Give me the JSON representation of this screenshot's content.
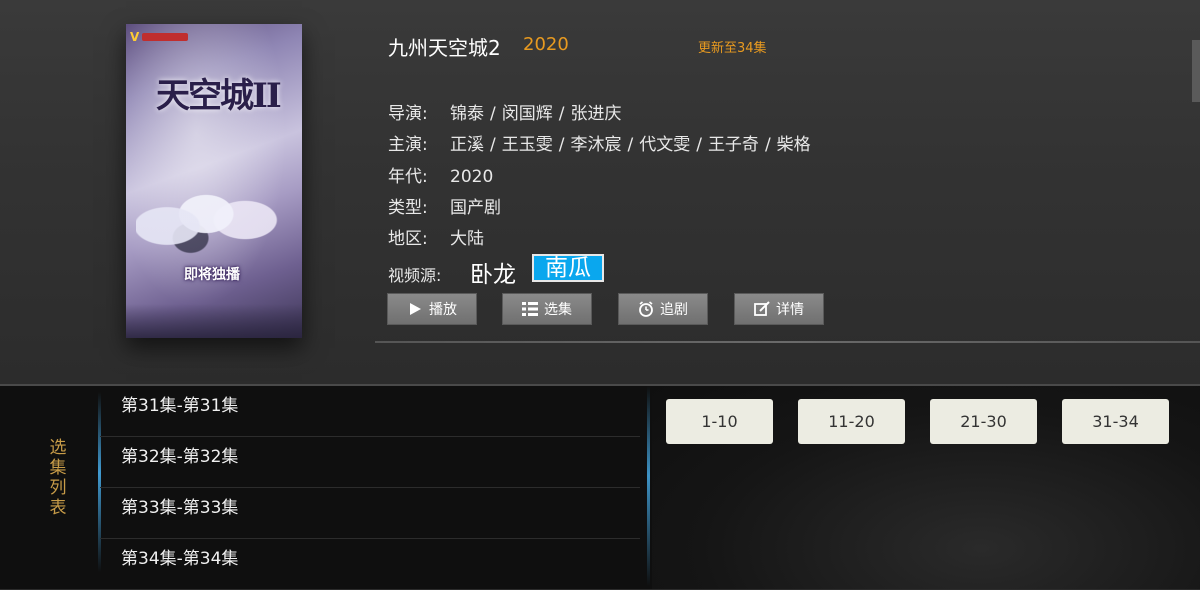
{
  "poster": {
    "brand": "V",
    "title_art": "天空城II",
    "banner": "即将独播"
  },
  "show": {
    "title": "九州天空城2",
    "year_tag": "2020",
    "update_status": "更新至34集"
  },
  "details": {
    "director_label": "导演:",
    "directors": [
      "锦泰",
      "闵国辉",
      "张进庆"
    ],
    "cast_label": "主演:",
    "cast": [
      "正溪",
      "王玉雯",
      "李沐宸",
      "代文雯",
      "王子奇",
      "柴格"
    ],
    "year_label": "年代:",
    "year": "2020",
    "genre_label": "类型:",
    "genre": "国产剧",
    "region_label": "地区:",
    "region": "大陆"
  },
  "sources": {
    "label": "视频源:",
    "items": [
      "卧龙",
      "南瓜"
    ],
    "selected": "南瓜"
  },
  "actions": {
    "play": "播放",
    "episodes": "选集",
    "follow": "追剧",
    "details": "详情"
  },
  "episode_panel": {
    "side_label": [
      "选",
      "集",
      "列",
      "表"
    ],
    "episodes": [
      "第31集-第31集",
      "第32集-第32集",
      "第33集-第33集",
      "第34集-第34集"
    ],
    "ranges": [
      "1-10",
      "11-20",
      "21-30",
      "31-34"
    ]
  },
  "colors": {
    "accent_orange": "#e89a20",
    "selected_source": "#0aa7ee",
    "side_label": "#c89c48"
  }
}
